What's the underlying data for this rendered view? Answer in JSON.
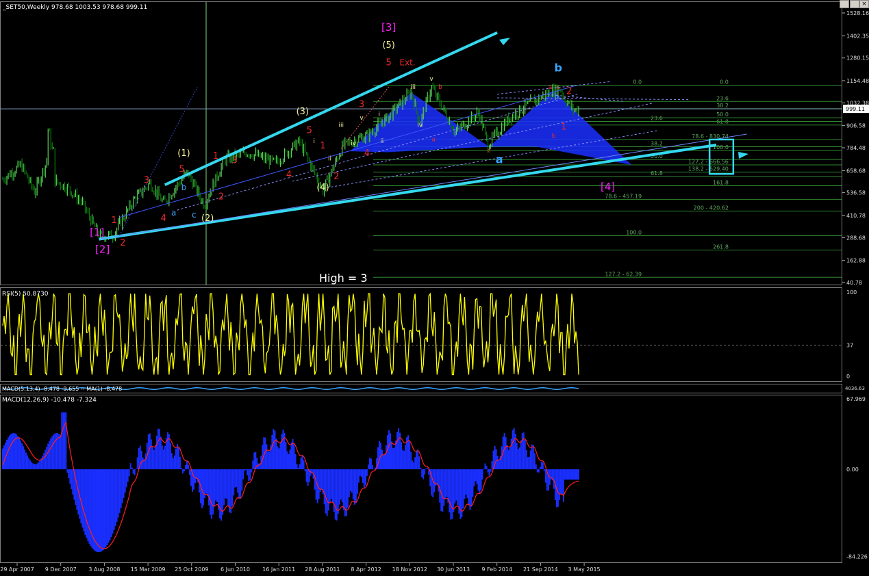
{
  "window": {
    "controls": [
      "minimize",
      "maximize",
      "close"
    ]
  },
  "main": {
    "header": "_SET50,Weekly  978.68 1003.53 978.68 999.11",
    "current_price": "999.11",
    "price_axis_labels": [
      "1528.16",
      "1402.35",
      "1280.15",
      "1154.48",
      "1032.38",
      "906.58",
      "784.48",
      "658.68",
      "536.58",
      "410.78",
      "288.68",
      "162.88",
      "40.78"
    ],
    "high_note": "High = 3",
    "colors": {
      "bull": "#5bd15b",
      "bear": "#0a7a0a",
      "trend": "#34d8ee",
      "harmonic": "#1a2fff",
      "wave_red": "#ee2a2a",
      "wave_magenta": "#ff22ff",
      "wave_yellow": "#f7f09a",
      "wave_blue": "#3aa6ff",
      "fib": "#2f8a2f"
    },
    "waves_primary": [
      {
        "label": "[1]",
        "x": 2008.72,
        "y": 300
      },
      {
        "label": "[2]",
        "x": 2008.8,
        "y": 205
      },
      {
        "label": "[3]",
        "x": 2013.02,
        "y": 1430
      },
      {
        "label": "[4]",
        "x": 2016.25,
        "y": 550
      }
    ],
    "waves_intermediate": [
      {
        "label": "(1)",
        "x": 2010.0,
        "y": 740
      },
      {
        "label": "(2)",
        "x": 2010.35,
        "y": 380
      },
      {
        "label": "(3)",
        "x": 2011.75,
        "y": 970
      },
      {
        "label": "(4)",
        "x": 2012.05,
        "y": 550
      },
      {
        "label": "(5)",
        "x": 2013.02,
        "y": 1335
      }
    ],
    "waves_minor_red": [
      {
        "label": "1",
        "x": 2008.97,
        "y": 370
      },
      {
        "label": "2",
        "x": 2009.1,
        "y": 245
      },
      {
        "label": "3",
        "x": 2009.45,
        "y": 590
      },
      {
        "label": "4",
        "x": 2009.7,
        "y": 380
      },
      {
        "label": "5",
        "x": 2009.97,
        "y": 650
      },
      {
        "label": "1",
        "x": 2010.47,
        "y": 725
      },
      {
        "label": "2",
        "x": 2010.55,
        "y": 500
      },
      {
        "label": "3",
        "x": 2010.75,
        "y": 700
      },
      {
        "label": "4",
        "x": 2011.55,
        "y": 620
      },
      {
        "label": "5",
        "x": 2011.85,
        "y": 865
      },
      {
        "label": "1",
        "x": 2012.05,
        "y": 780
      },
      {
        "label": "2",
        "x": 2012.25,
        "y": 610
      },
      {
        "label": "3",
        "x": 2012.62,
        "y": 1010
      },
      {
        "label": "4",
        "x": 2012.7,
        "y": 740
      },
      {
        "label": "5",
        "x": 2013.02,
        "y": 1240
      },
      {
        "label": "2",
        "x": 2015.68,
        "y": 1080
      },
      {
        "label": "1",
        "x": 2015.6,
        "y": 885
      }
    ],
    "waves_sub": [
      {
        "label": "a",
        "x": 2009.85,
        "y": 410,
        "color": "blue"
      },
      {
        "label": "b",
        "x": 2010.0,
        "y": 550,
        "color": "blue"
      },
      {
        "label": "c",
        "x": 2010.15,
        "y": 400,
        "color": "blue"
      },
      {
        "label": "i",
        "x": 2011.92,
        "y": 810,
        "color": "yellow"
      },
      {
        "label": "ii",
        "x": 2012.15,
        "y": 715,
        "color": "yellow"
      },
      {
        "label": "iii",
        "x": 2012.32,
        "y": 900,
        "color": "yellow"
      },
      {
        "label": "iv",
        "x": 2012.5,
        "y": 800,
        "color": "yellow"
      },
      {
        "label": "v",
        "x": 2012.62,
        "y": 940,
        "color": "yellow"
      },
      {
        "label": "i",
        "x": 2012.88,
        "y": 960,
        "color": "yellow"
      },
      {
        "label": "ii",
        "x": 2012.92,
        "y": 810,
        "color": "yellow"
      },
      {
        "label": "iii",
        "x": 2013.38,
        "y": 1110,
        "color": "yellow"
      },
      {
        "label": "iv",
        "x": 2013.48,
        "y": 900,
        "color": "yellow"
      },
      {
        "label": "v",
        "x": 2013.65,
        "y": 1155,
        "color": "yellow"
      },
      {
        "label": "a",
        "x": 2013.68,
        "y": 820,
        "color": "red"
      },
      {
        "label": "b",
        "x": 2013.78,
        "y": 1110,
        "color": "red"
      },
      {
        "label": "c",
        "x": 2014.5,
        "y": 760,
        "color": "red"
      },
      {
        "label": "a",
        "x": 2014.65,
        "y": 700,
        "color": "blue_big"
      },
      {
        "label": "b",
        "x": 2015.52,
        "y": 1205,
        "color": "blue_big"
      },
      {
        "label": "a",
        "x": 2015.4,
        "y": 1110,
        "color": "red"
      },
      {
        "label": "b",
        "x": 2015.45,
        "y": 840,
        "color": "red"
      },
      {
        "label": "c",
        "x": 2015.52,
        "y": 1110,
        "color": "red"
      }
    ],
    "ext_label": "Ext.",
    "fib_levels": [
      {
        "label": "0.0",
        "y": 1130,
        "x": 2016.75
      },
      {
        "label": "0.0",
        "y": 1130,
        "x": 2018.03
      },
      {
        "label": "23.6",
        "y": 1040,
        "x": 2018.03
      },
      {
        "label": "38.2",
        "y": 1000,
        "x": 2018.03
      },
      {
        "label": "50.0",
        "y": 950,
        "x": 2018.03
      },
      {
        "label": "61.8",
        "y": 910,
        "x": 2018.03
      },
      {
        "label": "23.6",
        "y": 930,
        "x": 2017.06
      },
      {
        "label": "38.2",
        "y": 790,
        "x": 2017.06
      },
      {
        "label": "50.0",
        "y": 720,
        "x": 2017.06
      },
      {
        "label": "61.8",
        "y": 625,
        "x": 2017.06
      },
      {
        "label": "78.6 - 830.74",
        "y": 830,
        "x": 2018.03
      },
      {
        "label": "100.0",
        "y": 770,
        "x": 2018.03
      },
      {
        "label": "127.2 - 666.56",
        "y": 690,
        "x": 2018.03
      },
      {
        "label": "138.2 - 629.40",
        "y": 650,
        "x": 2018.03
      },
      {
        "label": "161.8",
        "y": 575,
        "x": 2018.03
      },
      {
        "label": "78.6 - 457.19",
        "y": 500,
        "x": 2016.75
      },
      {
        "label": "200 - 420.62",
        "y": 435,
        "x": 2018.03
      },
      {
        "label": "100.0",
        "y": 300,
        "x": 2016.75
      },
      {
        "label": "261.8",
        "y": 220,
        "x": 2018.03
      },
      {
        "label": "127.2 - 62.39",
        "y": 70,
        "x": 2016.75
      }
    ],
    "target_box": {
      "x1": 2017.75,
      "x2": 2018.1,
      "y1": 640,
      "y2": 830
    }
  },
  "rsi": {
    "label": "RSI(5) 50.8730",
    "axis_labels": [
      "100",
      "37",
      "0"
    ],
    "level": 37
  },
  "macd_fast": {
    "label": "MACD(5,13,4) -8.478 -9.655 -- MA(1) -8.478",
    "axis_label": "4036.63"
  },
  "macd": {
    "label": "MACD(12,26,9) -10.478 -7.324",
    "axis_labels": [
      "67.969",
      "0.00",
      "-84.226"
    ]
  },
  "time_axis_labels": [
    "29 Apr 2007",
    "9 Dec 2007",
    "3 Aug 2008",
    "15 Mar 2009",
    "25 Oct 2009",
    "6 Jun 2010",
    "16 Jan 2011",
    "28 Aug 2011",
    "8 Apr 2012",
    "18 Nov 2012",
    "30 Jun 2013",
    "9 Feb 2014",
    "21 Sep 2014",
    "3 May 2015"
  ],
  "chart_data": [
    {
      "type": "line",
      "series": [
        {
          "values_ref": "generated-in-script"
        }
      ],
      "x": {
        "start": "29 Apr 2007",
        "end": "3 May 2015"
      },
      "ylim": [
        40.78,
        1528.16
      ],
      "anchors": [
        [
          2007.33,
          610
        ],
        [
          2007.6,
          690
        ],
        [
          2007.8,
          540
        ],
        [
          2008.0,
          730
        ],
        [
          2008.06,
          610
        ],
        [
          2008.3,
          560
        ],
        [
          2008.5,
          480
        ],
        [
          2008.75,
          300
        ],
        [
          2008.95,
          300
        ],
        [
          2009.25,
          490
        ],
        [
          2009.5,
          590
        ],
        [
          2009.7,
          480
        ],
        [
          2010.05,
          650
        ],
        [
          2010.3,
          470
        ],
        [
          2010.6,
          720
        ],
        [
          2010.95,
          760
        ],
        [
          2011.35,
          700
        ],
        [
          2011.7,
          820
        ],
        [
          2012.05,
          550
        ],
        [
          2012.35,
          800
        ],
        [
          2012.7,
          850
        ],
        [
          2013.0,
          950
        ],
        [
          2013.35,
          1090
        ],
        [
          2013.48,
          920
        ],
        [
          2013.65,
          1120
        ],
        [
          2014.0,
          870
        ],
        [
          2014.35,
          980
        ],
        [
          2014.48,
          800
        ],
        [
          2014.8,
          950
        ],
        [
          2015.1,
          1030
        ],
        [
          2015.4,
          1090
        ],
        [
          2015.55,
          1110
        ],
        [
          2015.6,
          1060
        ],
        [
          2015.75,
          990
        ],
        [
          2015.82,
          999.11
        ]
      ]
    },
    {
      "type": "line",
      "title": "RSI(5)",
      "ylim": [
        0,
        100
      ],
      "levels": [
        37
      ],
      "last": 50.873
    },
    {
      "type": "bar",
      "title": "MACD(12,26,9)",
      "ylim": [
        -84.226,
        67.969
      ],
      "last_main": -10.478,
      "last_signal": -7.324
    }
  ]
}
